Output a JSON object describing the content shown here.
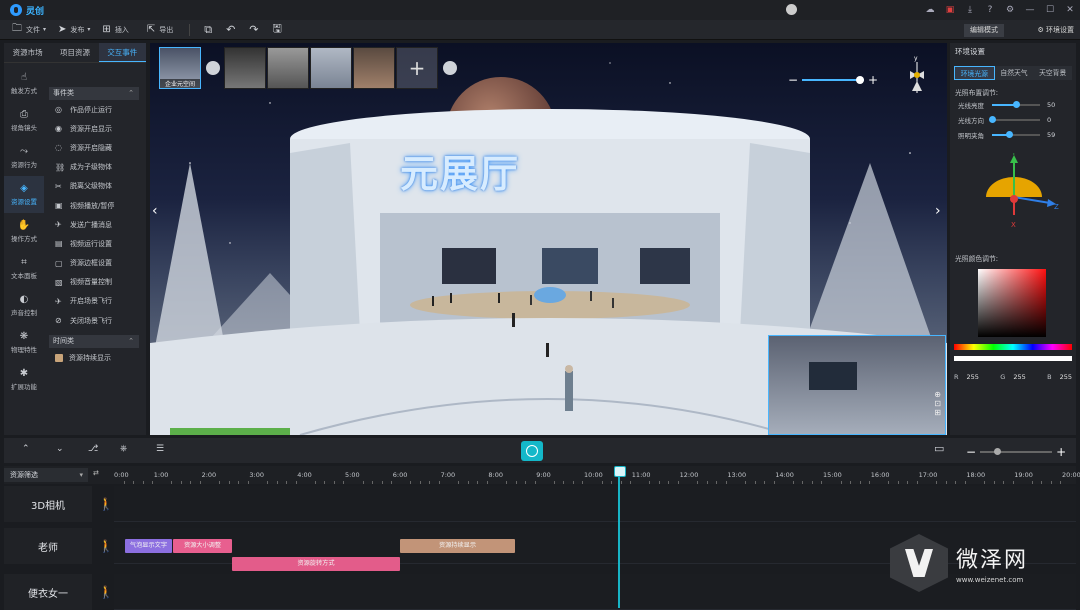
{
  "app": {
    "name": "灵创"
  },
  "toolbar": {
    "file": "文件",
    "publish": "发布",
    "insert": "插入",
    "export": "导出",
    "mode": "编辑模式",
    "env_settings": "环境设置"
  },
  "left": {
    "tabs": [
      "资源市场",
      "项目资源",
      "交互事件"
    ],
    "side": [
      "触发方式",
      "视角镜头",
      "资源行为",
      "资源设置",
      "操作方式",
      "文本面板",
      "声音控制",
      "物理特性",
      "扩展功能"
    ],
    "cat1": "事件类",
    "events": [
      "作品停止运行",
      "资源开启显示",
      "资源开启隐藏",
      "成为子级物体",
      "脱离父级物体",
      "视频播放/暂停",
      "发送广播消息",
      "视频运行设置",
      "资源边框设置",
      "视频音量控制",
      "开启场景飞行",
      "关闭场景飞行"
    ],
    "cat2": "时间类",
    "time_events": [
      "资源持续显示"
    ]
  },
  "viewport": {
    "hall_title": "元展厅",
    "thumb_label": "企业元空间"
  },
  "right": {
    "title": "环境设置",
    "tabs": [
      "环境光源",
      "自然天气",
      "天空背景"
    ],
    "light_section": "光照布置调节:",
    "sliders": [
      {
        "label": "光线亮度",
        "value": 50,
        "fraction": 0.5
      },
      {
        "label": "光线方向",
        "value": 0,
        "fraction": 0.0
      },
      {
        "label": "照明夹角",
        "value": 59,
        "fraction": 0.35
      }
    ],
    "axes": {
      "y": "Y",
      "z": "Z",
      "x": "X"
    },
    "color_section": "光照颜色调节:",
    "rgb": {
      "r_label": "R",
      "r": "255",
      "g_label": "G",
      "g": "255",
      "b_label": "B",
      "b": "255"
    }
  },
  "timeline": {
    "filter": "资源筛选",
    "ticks": [
      "0:00",
      "1:00",
      "2:00",
      "3:00",
      "4:00",
      "5:00",
      "6:00",
      "7:00",
      "8:00",
      "9:00",
      "10:00",
      "11:00",
      "12:00",
      "13:00",
      "14:00",
      "15:00",
      "16:00",
      "17:00",
      "18:00",
      "19:00",
      "20:00"
    ],
    "tracks": [
      {
        "label": "3D相机"
      },
      {
        "label": "老师"
      },
      {
        "label": "便衣女一"
      }
    ],
    "clips": [
      {
        "text": "气泡显示文字",
        "color": "#8c6fe0"
      },
      {
        "text": "资源大小调整",
        "color": "#e85f8f"
      },
      {
        "text": "资源持续显示",
        "color": "#c29478"
      },
      {
        "text": "资源旋转方式",
        "color": "#e35c8a"
      }
    ]
  },
  "watermark": {
    "name": "微泽网",
    "url": "www.weizenet.com"
  }
}
